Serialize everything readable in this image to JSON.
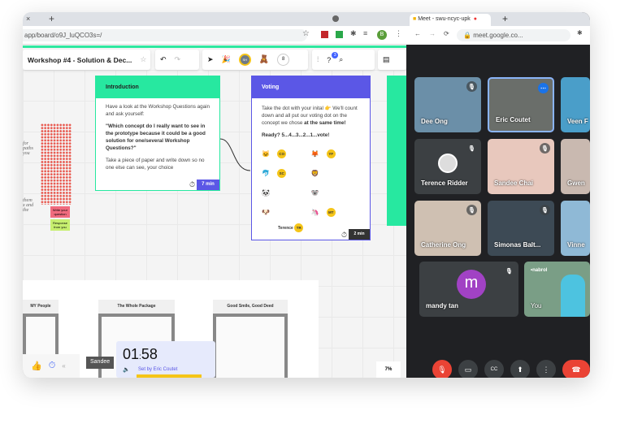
{
  "left_browser": {
    "url": "app/board/o9J_luQCO3s=/",
    "profile_initial": "B"
  },
  "board": {
    "title": "Workshop #4 - Solution & Dec...",
    "participant_count": "8",
    "help_badge": "3",
    "avatar_initials": "SH",
    "zoom": "7%"
  },
  "intro": {
    "title": "Introduction",
    "p1": "Have a look at the Workshop Questions again and ask yourself:",
    "p2": "\"Which concept do I really want to see in the prototype because it could be a good solution for one/several Workshop Questions?\"",
    "p3": "Take a piece of paper and write down so no one else can see, your choice",
    "timer": "7 min",
    "color": "#27e8a0"
  },
  "voting": {
    "title": "Voting",
    "p1": "Take the dot with your inital 👉 We'll count down and all put our voting dot on the concept we chose",
    "p1_bold": "at the same time!",
    "ready": "Ready?  5...4...3...2...1...vote!",
    "rows": [
      [
        "🐱",
        "CO",
        "🦊",
        "YF"
      ],
      [
        "🐬",
        "SC",
        "🦁",
        ""
      ],
      [
        "🐼",
        "",
        "🐨",
        ""
      ],
      [
        "🐶",
        "",
        "🦄",
        "MT"
      ]
    ],
    "terence": "Terence",
    "terence_badge": "TR",
    "timer": "2 min",
    "color": "#5b57e6"
  },
  "sticky": {
    "pink": "Write your question",
    "green": "Response from you",
    "handwriting1": "for\npaths\nyou",
    "handwriting2": "them\nx and\nthe"
  },
  "frames": [
    "MY People",
    "The Whole Package",
    "Good Smile, Good Deed"
  ],
  "timer_popup": {
    "time_min": "01",
    "time_sec": "58",
    "set_by": "Set by Eric Coutet"
  },
  "cursor_label": "Sandee",
  "meet": {
    "tab_title": "Meet - swu-ncyc-upk",
    "url": "meet.google.co...",
    "tiles": [
      {
        "name": "Dee Ong",
        "bg": "#6b8fa8"
      },
      {
        "name": "Eric Coutet",
        "bg": "#6a6e6a"
      },
      {
        "name": "Veen F",
        "bg": "#4a9ec9"
      },
      {
        "name": "Terence Ridder",
        "bg": "#3c4043"
      },
      {
        "name": "Sandee Chai",
        "bg": "#e8c8bd"
      },
      {
        "name": "Gwen",
        "bg": "#c9b9b0"
      },
      {
        "name": "Catherine Ong",
        "bg": "#cfc0b2"
      },
      {
        "name": "Simonas Balt...",
        "bg": "#3d4a55"
      },
      {
        "name": "Vinne",
        "bg": "#8fb9d6"
      }
    ],
    "mandy": {
      "name": "mandy tan",
      "initial": "m",
      "color": "#a142c4"
    },
    "you": {
      "name": "You",
      "logo": "•nabrol"
    }
  }
}
